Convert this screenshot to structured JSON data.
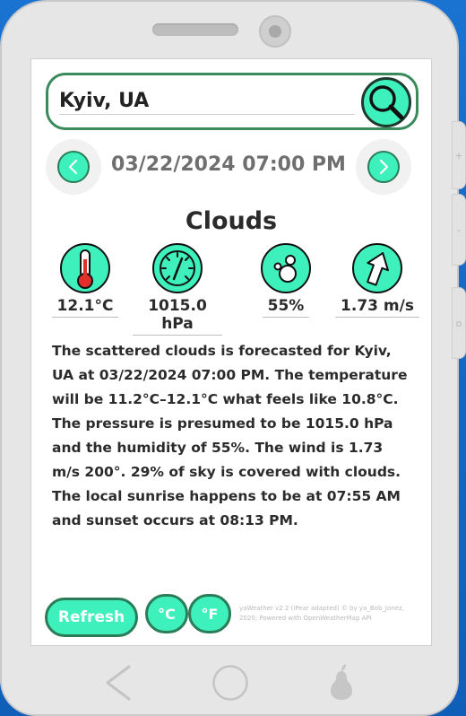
{
  "search": {
    "value": "Kyiv, UA",
    "icon": "search-icon"
  },
  "date": {
    "text": "03/22/2024 07:00 PM",
    "prev_icon": "chevron-left-icon",
    "next_icon": "chevron-right-icon"
  },
  "weather": {
    "condition": "Clouds",
    "temperature": "12.1°C",
    "pressure": "1015.0 hPa",
    "humidity": "55%",
    "wind": "1.73 m/s",
    "description": "The scattered clouds is forecasted for Kyiv, UA at 03/22/2024 07:00 PM. The temperature will be 11.2°C–12.1°C what feels like 10.8°C. The pressure is presumed to be 1015.0 hPa and the humidity of 55%. The wind is 1.73 m/s 200°. 29% of sky is covered with clouds. The local sunrise happens to be at 07:55 AM and sunset occurs at 08:13 PM."
  },
  "controls": {
    "refresh_label": "Refresh",
    "celsius_label": "°C",
    "fahrenheit_label": "°F"
  },
  "credits": "yaWeather v2.2 (iPear adapted) © by ya_Bob_Jonez, 2020; Powered with OpenWeatherMap API",
  "side_buttons": [
    "+",
    "-",
    "o"
  ],
  "colors": {
    "accent": "#3ef0bb",
    "accent_border": "#2b7c58",
    "background": "#1469c4"
  }
}
